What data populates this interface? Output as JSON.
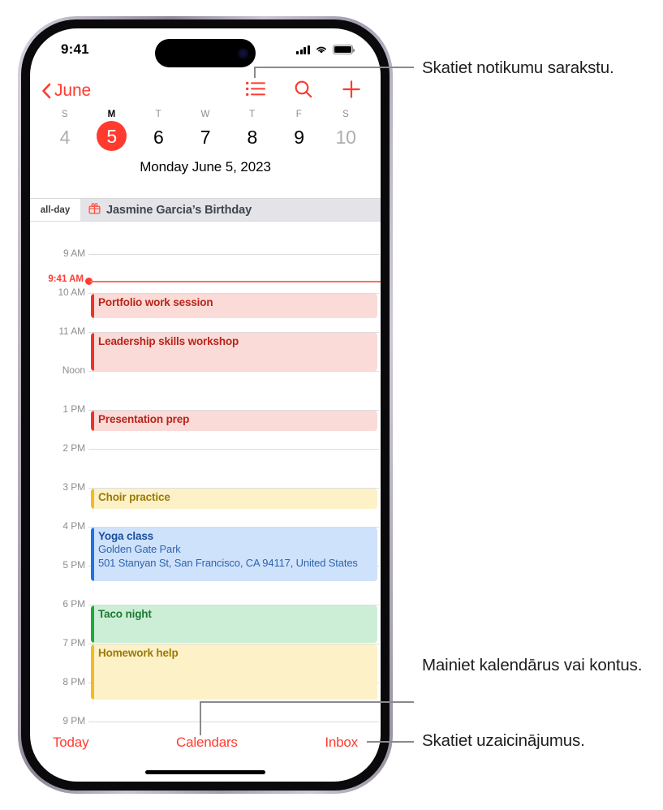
{
  "status_bar": {
    "time": "9:41",
    "cellular_icon": "signal-bars-icon",
    "wifi_icon": "wifi-icon",
    "battery_icon": "battery-icon"
  },
  "nav": {
    "back_icon": "chevron-left-icon",
    "back_label": "June",
    "list_icon": "list-view-icon",
    "search_icon": "search-icon",
    "add_icon": "plus-icon"
  },
  "week": {
    "day_initials": [
      "S",
      "M",
      "T",
      "W",
      "T",
      "F",
      "S"
    ],
    "dates": [
      "4",
      "5",
      "6",
      "7",
      "8",
      "9",
      "10"
    ],
    "selected_index": 1,
    "dim_indices": [
      0,
      6
    ],
    "full_date": "Monday  June 5, 2023"
  },
  "all_day": {
    "label": "all-day",
    "icon": "gift-icon",
    "event": "Jasmine Garcia’s Birthday"
  },
  "timeline": {
    "hours": [
      "9 AM",
      "10 AM",
      "11 AM",
      "Noon",
      "1 PM",
      "2 PM",
      "3 PM",
      "4 PM",
      "5 PM",
      "6 PM",
      "7 PM",
      "8 PM",
      "9 PM"
    ],
    "now_label": "9:41 AM",
    "events": [
      {
        "title": "Portfolio work session",
        "detail1": "",
        "detail2": "",
        "color": "red"
      },
      {
        "title": "Leadership skills workshop",
        "detail1": "",
        "detail2": "",
        "color": "red"
      },
      {
        "title": "Presentation prep",
        "detail1": "",
        "detail2": "",
        "color": "red"
      },
      {
        "title": "Choir practice",
        "detail1": "",
        "detail2": "",
        "color": "yellow"
      },
      {
        "title": "Yoga class",
        "detail1": "Golden Gate Park",
        "detail2": "501 Stanyan St, San Francisco, CA 94117, United States",
        "color": "blue"
      },
      {
        "title": "Taco night",
        "detail1": "",
        "detail2": "",
        "color": "green"
      },
      {
        "title": "Homework help",
        "detail1": "",
        "detail2": "",
        "color": "yellow"
      }
    ]
  },
  "bottom_bar": {
    "today": "Today",
    "calendars": "Calendars",
    "inbox": "Inbox"
  },
  "callouts": {
    "list_view": "Skatiet notikumu sarakstu.",
    "calendars": "Mainiet kalendārus vai kontus.",
    "inbox": "Skatiet uzaicinājumus."
  },
  "colors": {
    "accent_red": "#ff3b30",
    "event_red_bg": "#fadbd7",
    "event_red_text": "#b8241c",
    "event_yellow_bg": "#fdf1c8",
    "event_yellow_text": "#9a7b06",
    "event_blue_bg": "#cfe2fb",
    "event_blue_text": "#1a4f9c",
    "event_green_bg": "#cdeed6",
    "event_green_text": "#1d7a33"
  }
}
